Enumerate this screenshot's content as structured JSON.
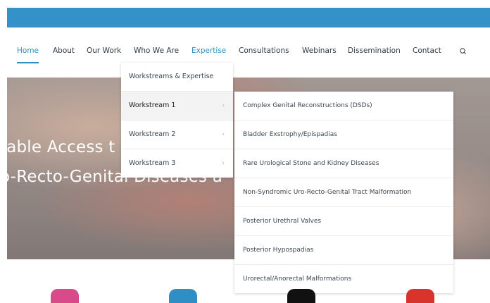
{
  "nav": {
    "items": [
      "Home",
      "About",
      "Our Work",
      "Who We Are",
      "Expertise",
      "Consultations",
      "Webinars",
      "Dissemination",
      "Contact"
    ],
    "active": "Home",
    "hovered": "Expertise",
    "accent_color": "#2f8fc4",
    "search_icon": "search-icon"
  },
  "topbar": {
    "color": "#3592c9"
  },
  "hero": {
    "line1": "table Access t",
    "line2": "o-Recto-Genital Diseases a"
  },
  "expertise_menu": {
    "items": [
      {
        "label": "Workstreams & Expertise",
        "has_submenu": false
      },
      {
        "label": "Workstream 1",
        "has_submenu": true
      },
      {
        "label": "Workstream 2",
        "has_submenu": true
      },
      {
        "label": "Workstream 3",
        "has_submenu": true
      }
    ],
    "caret": "›"
  },
  "workstream1_menu": {
    "items": [
      "Complex Genital Reconstructions (DSDs)",
      "Bladder Exstrophy/Epispadias",
      "Rare Urological Stone and Kidney Diseases",
      "Non-Syndromic Uro-Recto-Genital Tract Malformation",
      "Posterior Urethral Valves",
      "Posterior Hypospadias",
      "Urorectal/Anorectal Malformations"
    ]
  },
  "social_colors": [
    "#d84a8a",
    "#2f8fc4",
    "#111111",
    "#d9342b"
  ]
}
